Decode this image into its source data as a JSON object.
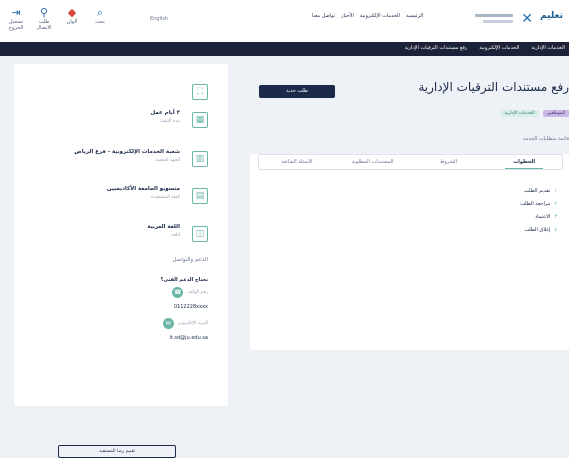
{
  "toolbar": {
    "tools": [
      {
        "label": "تسجيل الخروج",
        "icon": "logout-icon"
      },
      {
        "label": "طلب الاتصال",
        "icon": "user-icon"
      },
      {
        "label": "ألوان",
        "icon": "palette-icon"
      },
      {
        "label": "بحث",
        "icon": "search-icon"
      }
    ],
    "lang": "English"
  },
  "top_links": [
    "الرئيسية",
    "الخدمات الإلكترونية",
    "الأخبار",
    "تواصل معنا"
  ],
  "brand": {
    "logo_text": "تعليم"
  },
  "navbar": {
    "items": [
      "الخدمات الإدارية",
      "الخدمات الإلكترونية",
      "رفع مستندات الترقيات الإدارية"
    ]
  },
  "sidebar": {
    "items": [
      {
        "title": "",
        "subtitle": "",
        "icon": "qr-icon"
      },
      {
        "title": "٣ أيام عمل",
        "subtitle": "مدة التنفيذ",
        "icon": "calendar-icon"
      },
      {
        "title": "شعبة الخدمات الإلكترونية - فرع الرياض",
        "subtitle": "الجهة المعنية",
        "icon": "building-icon"
      },
      {
        "title": "منسوبو الجامعة الأكاديميين",
        "subtitle": "الفئة المستفيدة",
        "icon": "users-icon"
      },
      {
        "title": "اللغة العربية",
        "subtitle": "اللغة",
        "icon": "language-icon"
      }
    ],
    "notice": "الدعم والتواصل",
    "contact_heading": "تحتاج الدعم الفني؟",
    "phone_label": "رقم الهاتف",
    "phone": "0112228xxxx",
    "email_label": "البريد الإلكتروني",
    "email": "it.sd@ju.edu.sa",
    "button": "تقييم رضا المستفيد"
  },
  "main": {
    "title": "رفع مستندات الترقيات الإدارية",
    "new_button": "طلب جديد",
    "badges": [
      "الموظفين",
      "الخدمات الإدارية"
    ],
    "notice": "قائمة متطلبات الخدمة",
    "tabs": [
      "الخطوات",
      "الشروط",
      "المستندات المطلوبة",
      "الأسئلة الشائعة"
    ],
    "steps": [
      "تقديم الطلب",
      "مراجعة الطلب",
      "الاعتماد",
      "إغلاق الطلب"
    ]
  }
}
